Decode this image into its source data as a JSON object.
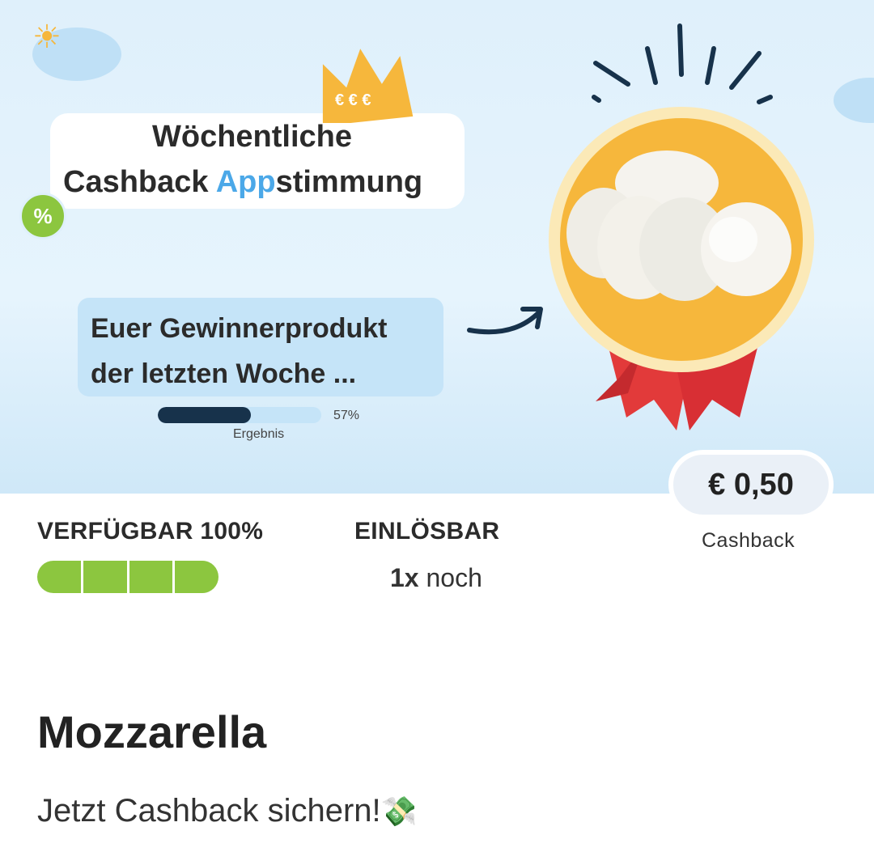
{
  "banner": {
    "title_line1": "Wöchentliche",
    "title_line2_part1": "Cashback ",
    "title_line2_highlight": "App",
    "title_line2_part2": "stimmung",
    "winner_text": "Euer Gewinnerprodukt\nder letzten Woche ...",
    "result_percent_text": "57%",
    "result_fraction": 0.57,
    "result_label": "Ergebnis",
    "percent_badge": "%",
    "crown_symbols": "€ € €"
  },
  "offer": {
    "price": "€ 0,50",
    "price_caption": "Cashback",
    "availability_label": "VERFÜGBAR 100%",
    "availability_fraction": 1.0,
    "redeem_label": "EINLÖSBAR",
    "redeem_count_bold": "1x",
    "redeem_count_rest": " noch"
  },
  "product": {
    "title": "Mozzarella",
    "subtitle": "Jetzt Cashback sichern!",
    "subtitle_emoji": "💸"
  },
  "colors": {
    "accent_blue": "#4ba8e8",
    "green": "#8cc63f",
    "medal_gold": "#f6b73c",
    "ribbon_red": "#e23a3a",
    "dark_navy": "#17324b"
  }
}
